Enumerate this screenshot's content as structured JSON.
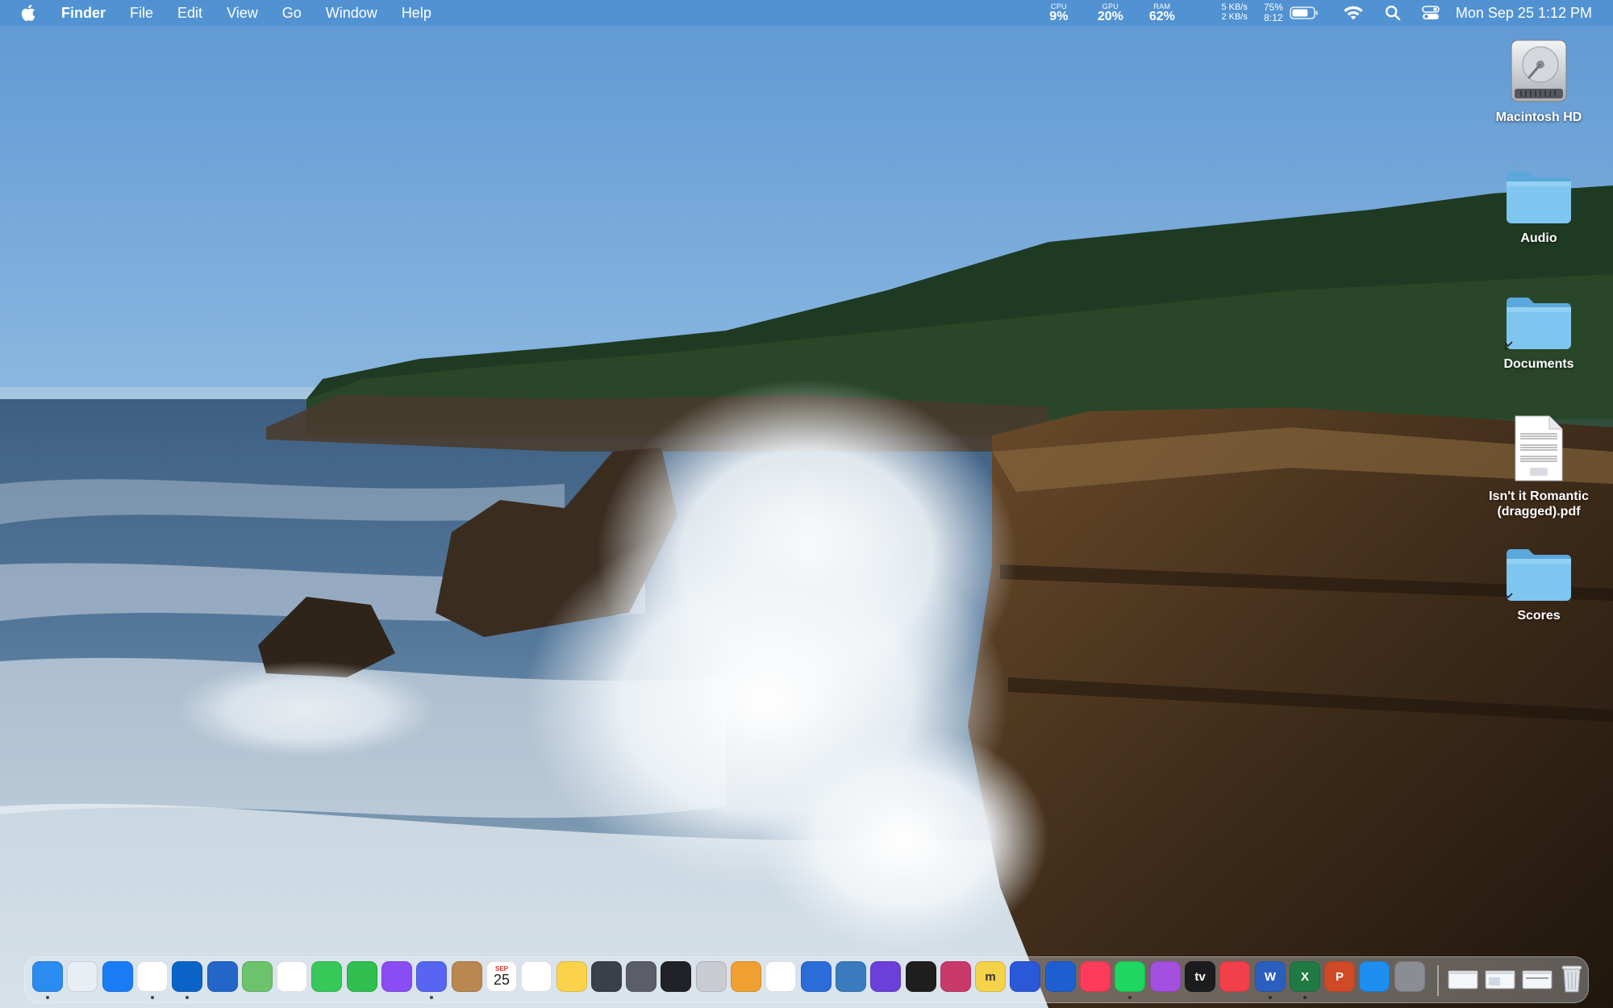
{
  "menubar": {
    "app_name": "Finder",
    "menus": [
      "File",
      "Edit",
      "View",
      "Go",
      "Window",
      "Help"
    ],
    "cpu": {
      "label": "CPU",
      "value": "9%"
    },
    "gpu": {
      "label": "GPU",
      "value": "20%"
    },
    "ram": {
      "label": "RAM",
      "value": "62%"
    },
    "net_up": "5 KB/s",
    "net_down": "2 KB/s",
    "battery_percent": "75%",
    "battery_time": "8:12",
    "battery_level": 0.75,
    "clock": "Mon Sep 25  1:12 PM"
  },
  "desktop": {
    "icons": [
      {
        "label": "Macintosh HD",
        "icon": "hard-drive-icon"
      },
      {
        "label": "Audio",
        "icon": "folder-icon"
      },
      {
        "label": "Documents",
        "icon": "folder-alias-icon"
      },
      {
        "label": "Isn't it Romantic (dragged).pdf",
        "icon": "pdf-file-icon"
      },
      {
        "label": "Scores",
        "icon": "folder-alias-icon"
      }
    ]
  },
  "dock": {
    "calendar_month": "SEP",
    "calendar_day": "25",
    "apps": [
      {
        "name": "finder",
        "color": "#2a8cf0",
        "glyph": ""
      },
      {
        "name": "launchpad",
        "color": "#e9eef5",
        "glyph": ""
      },
      {
        "name": "safari",
        "color": "#1a7cf5",
        "glyph": ""
      },
      {
        "name": "chrome",
        "color": "#ffffff",
        "glyph": ""
      },
      {
        "name": "outlook",
        "color": "#0a64c8",
        "glyph": ""
      },
      {
        "name": "mission-control",
        "color": "#2466c8",
        "glyph": ""
      },
      {
        "name": "maps",
        "color": "#6cc36c",
        "glyph": ""
      },
      {
        "name": "photos",
        "color": "#ffffff",
        "glyph": ""
      },
      {
        "name": "messages",
        "color": "#38c85a",
        "glyph": ""
      },
      {
        "name": "facetime",
        "color": "#2fbe4f",
        "glyph": ""
      },
      {
        "name": "messenger",
        "color": "#8a4cf5",
        "glyph": ""
      },
      {
        "name": "discord",
        "color": "#5865f2",
        "glyph": ""
      },
      {
        "name": "contacts",
        "color": "#b9874f",
        "glyph": ""
      },
      {
        "name": "calendar",
        "color": "#ffffff",
        "glyph": ""
      },
      {
        "name": "reminders",
        "color": "#ffffff",
        "glyph": ""
      },
      {
        "name": "notes",
        "color": "#fbd34a",
        "glyph": ""
      },
      {
        "name": "davinci-resolve",
        "color": "#3a3f4a",
        "glyph": ""
      },
      {
        "name": "compressor",
        "color": "#5b5e66",
        "glyph": ""
      },
      {
        "name": "obs",
        "color": "#202227",
        "glyph": ""
      },
      {
        "name": "disk-utility",
        "color": "#c9cbd0",
        "glyph": ""
      },
      {
        "name": "ableton",
        "color": "#f0a030",
        "glyph": ""
      },
      {
        "name": "capcut",
        "color": "#ffffff",
        "glyph": ""
      },
      {
        "name": "audio-hijack",
        "color": "#2a6cd8",
        "glyph": ""
      },
      {
        "name": "loopback",
        "color": "#3a7bbf",
        "glyph": ""
      },
      {
        "name": "musescore",
        "color": "#6b3fd8",
        "glyph": ""
      },
      {
        "name": "activity-monitor",
        "color": "#1e1e1e",
        "glyph": ""
      },
      {
        "name": "wavelab",
        "color": "#c83a6a",
        "glyph": ""
      },
      {
        "name": "mixcraft",
        "color": "#f4d24a",
        "glyph": "m"
      },
      {
        "name": "app-switcher",
        "color": "#2a58d8",
        "glyph": ""
      },
      {
        "name": "bitwarden",
        "color": "#1d5fd1",
        "glyph": ""
      },
      {
        "name": "music",
        "color": "#fc3c5a",
        "glyph": ""
      },
      {
        "name": "spotify",
        "color": "#1ed760",
        "glyph": ""
      },
      {
        "name": "podcasts",
        "color": "#a34fe0",
        "glyph": ""
      },
      {
        "name": "apple-tv",
        "color": "#1c1c1e",
        "glyph": "tv"
      },
      {
        "name": "news",
        "color": "#f2404a",
        "glyph": ""
      },
      {
        "name": "word",
        "color": "#2b5fbf",
        "glyph": "W"
      },
      {
        "name": "excel",
        "color": "#1f7a44",
        "glyph": "X"
      },
      {
        "name": "powerpoint",
        "color": "#d04a26",
        "glyph": "P"
      },
      {
        "name": "app-store",
        "color": "#1e8ef0",
        "glyph": ""
      },
      {
        "name": "system-settings",
        "color": "#8a8d94",
        "glyph": ""
      }
    ],
    "others": [
      {
        "name": "recent-window-1"
      },
      {
        "name": "recent-window-2"
      },
      {
        "name": "recent-window-3"
      },
      {
        "name": "trash"
      }
    ]
  }
}
